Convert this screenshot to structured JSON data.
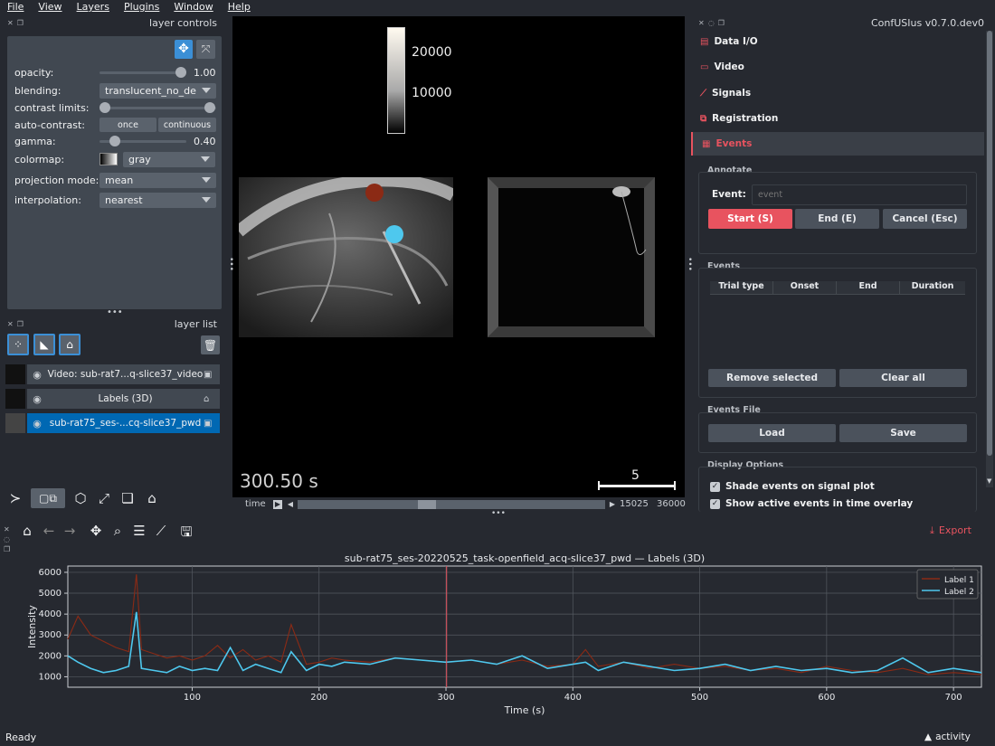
{
  "menu": [
    "File",
    "View",
    "Layers",
    "Plugins",
    "Window",
    "Help"
  ],
  "layer_controls": {
    "title": "layer controls",
    "opacity_label": "opacity:",
    "opacity_value": "1.00",
    "opacity_level": 1.0,
    "blending_label": "blending:",
    "blending_value": "translucent_no_de",
    "contrast_label": "contrast limits:",
    "autocontrast_label": "auto-contrast:",
    "once_label": "once",
    "continuous_label": "continuous",
    "gamma_label": "gamma:",
    "gamma_value": "0.40",
    "colormap_label": "colormap:",
    "colormap_value": "gray",
    "projection_label": "projection mode:",
    "projection_value": "mean",
    "interpolation_label": "interpolation:",
    "interpolation_value": "nearest"
  },
  "layer_list": {
    "title": "layer list",
    "layers": [
      {
        "name": "Video: sub-rat7...q-slice37_video",
        "type_icon": "image-icon",
        "selected": false
      },
      {
        "name": "Labels (3D)",
        "type_icon": "label-icon",
        "selected": false
      },
      {
        "name": "sub-rat75_ses-...cq-slice37_pwd",
        "type_icon": "image-icon",
        "selected": true
      }
    ]
  },
  "viewer": {
    "colorbar_ticks": [
      "20000",
      "10000"
    ],
    "time_label": "300.50 s",
    "scale_label": "5",
    "slider_label": "time",
    "slider_value": "15025",
    "slider_max": "36000",
    "slider_fraction": 0.417
  },
  "plugin": {
    "title": "ConfUSIus v0.7.0.dev0",
    "nav": [
      {
        "label": "Data I/O",
        "icon": "file-icon",
        "active": false
      },
      {
        "label": "Video",
        "icon": "video-icon",
        "active": false
      },
      {
        "label": "Signals",
        "icon": "signal-icon",
        "active": false
      },
      {
        "label": "Registration",
        "icon": "registration-icon",
        "active": false
      },
      {
        "label": "Events",
        "icon": "events-icon",
        "active": true
      }
    ],
    "annotate_title": "Annotate",
    "event_label": "Event:",
    "event_placeholder": "event",
    "start_label": "Start (S)",
    "end_label": "End (E)",
    "cancel_label": "Cancel (Esc)",
    "events_title": "Events",
    "columns": [
      "Trial type",
      "Onset",
      "End",
      "Duration"
    ],
    "remove_label": "Remove selected",
    "clear_label": "Clear all",
    "file_title": "Events File",
    "load_label": "Load",
    "save_label": "Save",
    "display_title": "Display Options",
    "opt1": "Shade events on signal plot",
    "opt2": "Show active events in time overlay"
  },
  "plot_toolbar": {
    "export_label": "Export"
  },
  "status": {
    "left": "Ready",
    "right": "activity"
  },
  "colors": {
    "accent": "#e8535f",
    "selected": "#0068b3",
    "label1": "#8b2a15",
    "label2": "#4ec8ee",
    "cursor": "#e8535f"
  },
  "chart_data": {
    "type": "line",
    "title": "sub-rat75_ses-20220525_task-openfield_acq-slice37_pwd — Labels (3D)",
    "xlabel": "Time (s)",
    "ylabel": "Intensity",
    "xlim": [
      2,
      722
    ],
    "ylim": [
      500,
      6300
    ],
    "xticks": [
      100,
      200,
      300,
      400,
      500,
      600,
      700
    ],
    "yticks": [
      1000,
      2000,
      3000,
      4000,
      5000,
      6000
    ],
    "grid": true,
    "legend_position": "top-right",
    "cursor_x": 300.5,
    "series": [
      {
        "name": "Label 1",
        "color": "#8b2a15",
        "x": [
          2,
          10,
          20,
          30,
          40,
          50,
          56,
          60,
          70,
          80,
          90,
          100,
          110,
          120,
          130,
          140,
          150,
          160,
          170,
          178,
          190,
          200,
          210,
          220,
          240,
          260,
          280,
          300,
          320,
          340,
          360,
          380,
          400,
          410,
          420,
          440,
          460,
          480,
          500,
          520,
          540,
          560,
          580,
          600,
          620,
          640,
          660,
          680,
          700,
          722
        ],
        "y": [
          2800,
          3900,
          3000,
          2700,
          2400,
          2200,
          5900,
          2300,
          2100,
          1900,
          2000,
          1800,
          2000,
          2500,
          1900,
          2300,
          1800,
          2000,
          1700,
          3500,
          1600,
          1700,
          1900,
          1800,
          1700,
          1900,
          1800,
          1700,
          1800,
          1600,
          1800,
          1500,
          1600,
          2300,
          1500,
          1700,
          1400,
          1600,
          1400,
          1500,
          1300,
          1400,
          1200,
          1500,
          1300,
          1200,
          1400,
          1100,
          1200,
          1100
        ]
      },
      {
        "name": "Label 2",
        "color": "#4ec8ee",
        "x": [
          2,
          10,
          20,
          30,
          40,
          50,
          56,
          60,
          70,
          80,
          90,
          100,
          110,
          120,
          130,
          140,
          150,
          160,
          170,
          178,
          190,
          200,
          210,
          220,
          240,
          260,
          280,
          300,
          320,
          340,
          360,
          380,
          400,
          410,
          420,
          440,
          460,
          480,
          500,
          520,
          540,
          560,
          580,
          600,
          620,
          640,
          660,
          680,
          700,
          722
        ],
        "y": [
          2000,
          1700,
          1400,
          1200,
          1300,
          1500,
          4100,
          1400,
          1300,
          1200,
          1500,
          1300,
          1400,
          1300,
          2400,
          1300,
          1600,
          1400,
          1200,
          2200,
          1300,
          1600,
          1500,
          1700,
          1600,
          1900,
          1800,
          1700,
          1800,
          1600,
          2000,
          1400,
          1600,
          1700,
          1300,
          1700,
          1500,
          1300,
          1400,
          1600,
          1300,
          1500,
          1300,
          1400,
          1200,
          1300,
          1900,
          1200,
          1400,
          1200
        ]
      }
    ]
  }
}
